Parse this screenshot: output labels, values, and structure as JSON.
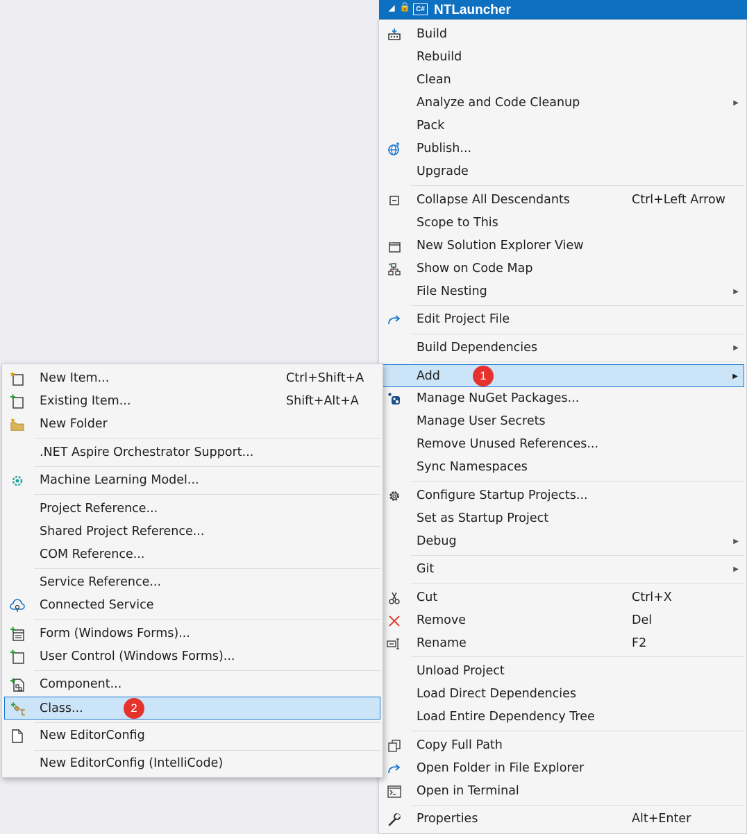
{
  "header": {
    "project_name": "NTLauncher",
    "lang_badge": "C#",
    "expand_glyph": "◢",
    "lock_glyph": "🔒"
  },
  "main_menu": {
    "items": [
      {
        "label": "Build",
        "icon": "build-icon"
      },
      {
        "label": "Rebuild"
      },
      {
        "label": "Clean"
      },
      {
        "label": "Analyze and Code Cleanup",
        "submenu": true
      },
      {
        "label": "Pack"
      },
      {
        "label": "Publish...",
        "icon": "globe-publish-icon"
      },
      {
        "label": "Upgrade"
      },
      {
        "label": "Collapse All Descendants",
        "shortcut": "Ctrl+Left Arrow",
        "icon": "collapse-icon"
      },
      {
        "label": "Scope to This"
      },
      {
        "label": "New Solution Explorer View",
        "icon": "new-window-icon"
      },
      {
        "label": "Show on Code Map",
        "icon": "code-map-icon"
      },
      {
        "label": "File Nesting",
        "submenu": true
      },
      {
        "label": "Edit Project File",
        "icon": "redo-arrow-icon"
      },
      {
        "label": "Build Dependencies",
        "submenu": true
      },
      {
        "label": "Add",
        "submenu": true,
        "highlighted": true,
        "badge": "1"
      },
      {
        "label": "Manage NuGet Packages...",
        "icon": "nuget-icon"
      },
      {
        "label": "Manage User Secrets"
      },
      {
        "label": "Remove Unused References..."
      },
      {
        "label": "Sync Namespaces"
      },
      {
        "label": "Configure Startup Projects...",
        "icon": "gear-icon"
      },
      {
        "label": "Set as Startup Project"
      },
      {
        "label": "Debug",
        "submenu": true
      },
      {
        "label": "Git",
        "submenu": true
      },
      {
        "label": "Cut",
        "shortcut": "Ctrl+X",
        "icon": "scissors-icon"
      },
      {
        "label": "Remove",
        "shortcut": "Del",
        "icon": "remove-x-icon"
      },
      {
        "label": "Rename",
        "shortcut": "F2",
        "icon": "rename-icon"
      },
      {
        "label": "Unload Project"
      },
      {
        "label": "Load Direct Dependencies"
      },
      {
        "label": "Load Entire Dependency Tree"
      },
      {
        "label": "Copy Full Path",
        "icon": "copy-icon"
      },
      {
        "label": "Open Folder in File Explorer",
        "icon": "open-folder-arrow-icon"
      },
      {
        "label": "Open in Terminal",
        "icon": "terminal-icon"
      },
      {
        "label": "Properties",
        "shortcut": "Alt+Enter",
        "icon": "wrench-icon"
      }
    ]
  },
  "add_submenu": {
    "items": [
      {
        "label": "New Item...",
        "shortcut": "Ctrl+Shift+A",
        "icon": "new-item-icon"
      },
      {
        "label": "Existing Item...",
        "shortcut": "Shift+Alt+A",
        "icon": "existing-item-icon"
      },
      {
        "label": "New Folder",
        "icon": "new-folder-icon"
      },
      {
        "label": ".NET Aspire Orchestrator Support..."
      },
      {
        "label": "Machine Learning Model...",
        "icon": "ml-model-icon"
      },
      {
        "label": "Project Reference..."
      },
      {
        "label": "Shared Project Reference..."
      },
      {
        "label": "COM Reference..."
      },
      {
        "label": "Service Reference..."
      },
      {
        "label": "Connected Service",
        "icon": "connected-service-icon"
      },
      {
        "label": "Form (Windows Forms)...",
        "icon": "form-icon"
      },
      {
        "label": "User Control (Windows Forms)...",
        "icon": "user-control-icon"
      },
      {
        "label": "Component...",
        "icon": "component-icon"
      },
      {
        "label": "Class...",
        "icon": "class-icon",
        "highlighted": true,
        "badge": "2"
      },
      {
        "label": "New EditorConfig",
        "icon": "document-icon"
      },
      {
        "label": "New EditorConfig (IntelliCode)"
      }
    ]
  },
  "colors": {
    "accent": "#0e70c0",
    "highlight_bg": "#cce4f7",
    "highlight_border": "#1a76d2",
    "badge": "#e5322d"
  }
}
